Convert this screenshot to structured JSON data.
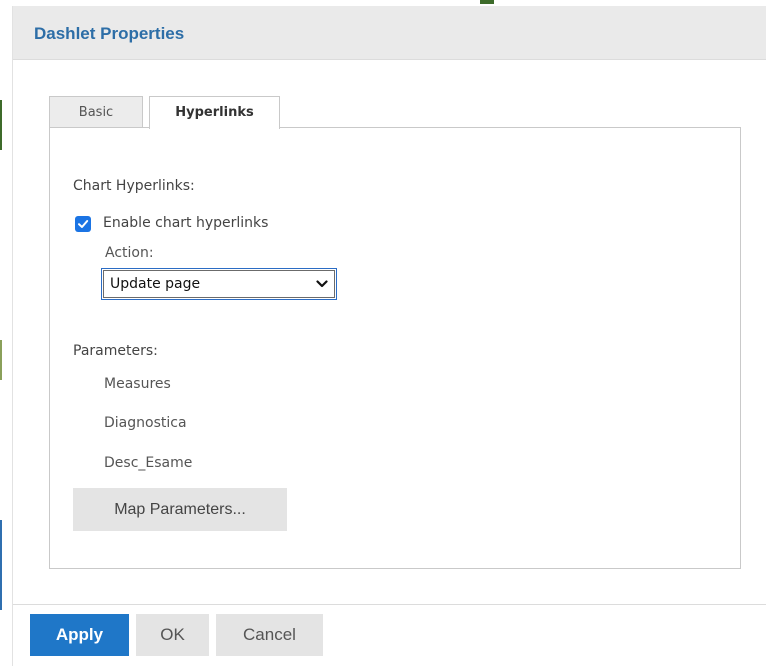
{
  "dialog": {
    "title": "Dashlet Properties"
  },
  "tabs": [
    {
      "label": "Basic",
      "active": false
    },
    {
      "label": "Hyperlinks",
      "active": true
    }
  ],
  "hyperlinks": {
    "section_label": "Chart Hyperlinks:",
    "enable_checkbox": {
      "label": "Enable chart hyperlinks",
      "checked": true
    },
    "action_label": "Action:",
    "action_select": {
      "value": "Update page"
    },
    "parameters_label": "Parameters:",
    "parameters": [
      "Measures",
      "Diagnostica",
      "Desc_Esame"
    ],
    "map_button": "Map Parameters..."
  },
  "footer": {
    "apply": "Apply",
    "ok": "OK",
    "cancel": "Cancel"
  },
  "colors": {
    "accent": "#1f77c8",
    "title": "#2d6ea7",
    "checkbox": "#1b74e4"
  },
  "icons": {
    "checkbox": "checkmark-icon",
    "select": "chevron-down-icon"
  }
}
